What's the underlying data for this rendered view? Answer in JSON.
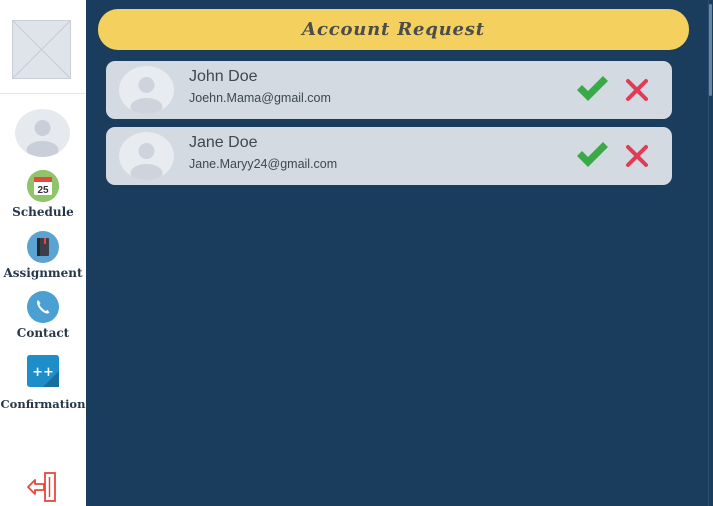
{
  "sidebar": {
    "logo_icon": "image-placeholder-icon",
    "avatar_icon": "user-avatar-icon",
    "items": [
      {
        "label": "Schedule",
        "icon": "calendar-icon",
        "icon_text": "25"
      },
      {
        "label": "Assignment",
        "icon": "notebook-icon"
      },
      {
        "label": "Contact",
        "icon": "phone-icon"
      },
      {
        "label": "Confirmation",
        "icon": "plus-plus-icon",
        "icon_text": "++"
      }
    ],
    "logout_icon": "logout-icon"
  },
  "header": {
    "title": "Account Request"
  },
  "requests": [
    {
      "name": "John Doe",
      "email": "Joehn.Mama@gmail.com"
    },
    {
      "name": "Jane Doe",
      "email": "Jane.Maryy24@gmail.com"
    }
  ],
  "colors": {
    "main_bg": "#1a3d5e",
    "header_bg": "#f4d15e",
    "card_bg": "#d3dae2",
    "approve": "#3aaa48",
    "reject": "#e23b57"
  }
}
